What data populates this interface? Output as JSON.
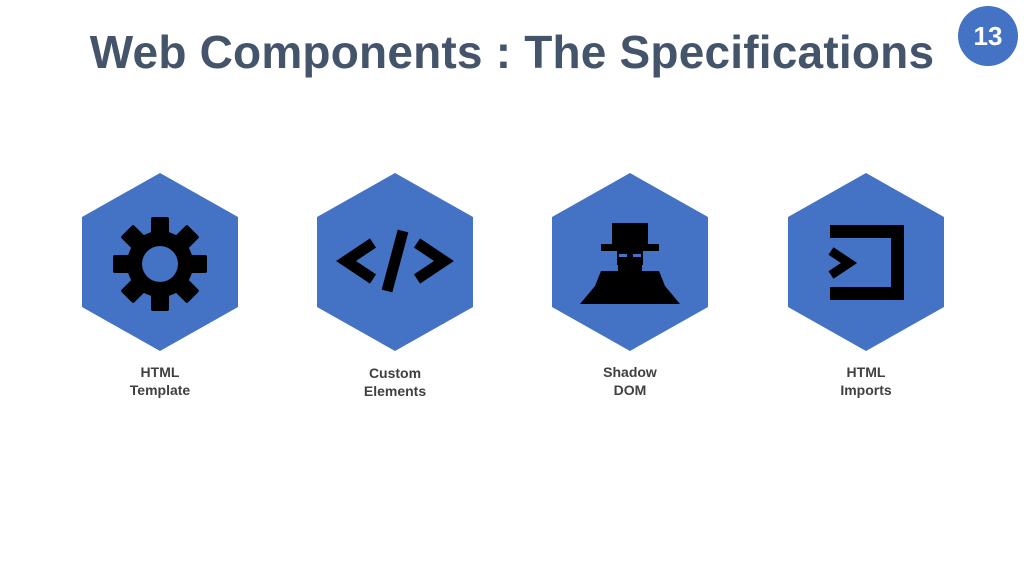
{
  "slide": {
    "title": "Web Components : The Specifications",
    "page_number": "13"
  },
  "colors": {
    "hex_fill": "#4472c4",
    "icon_fill": "#000000",
    "title_color": "#44546a",
    "badge_fill": "#4472c4"
  },
  "items": [
    {
      "icon": "gear-icon",
      "line1": "HTML",
      "line2": "Template"
    },
    {
      "icon": "code-brackets-icon",
      "line1": "Custom",
      "line2": "Elements"
    },
    {
      "icon": "spy-incognito-icon",
      "line1": "Shadow",
      "line2": "DOM"
    },
    {
      "icon": "import-arrow-icon",
      "line1": "HTML",
      "line2": "Imports"
    }
  ]
}
